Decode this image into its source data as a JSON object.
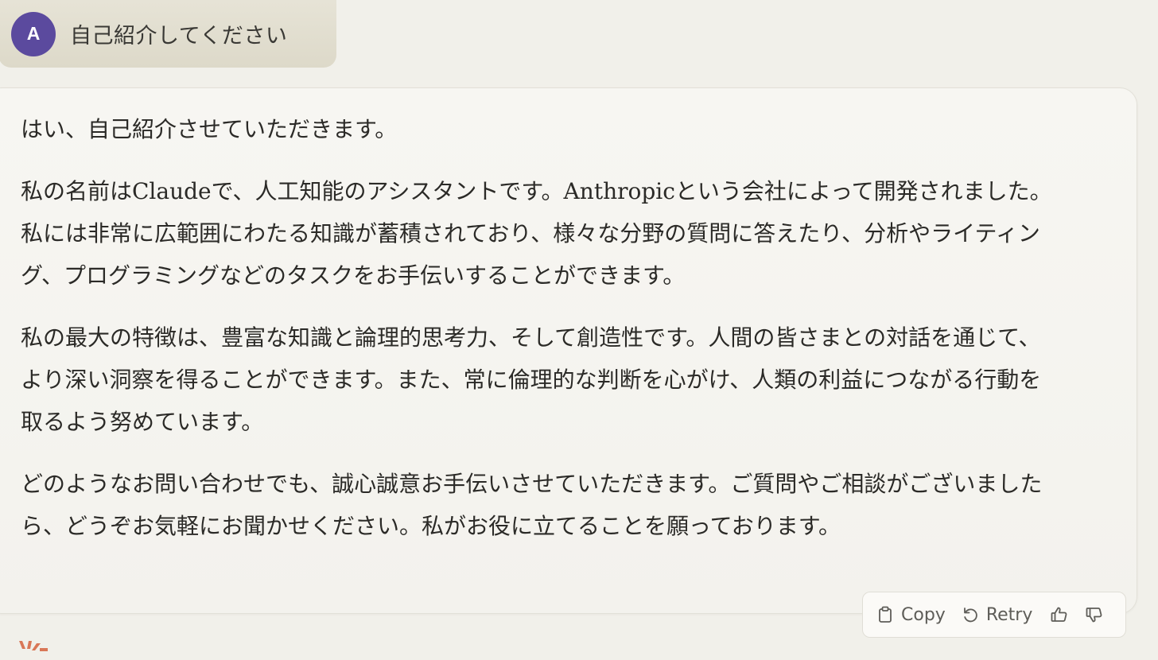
{
  "user_message": {
    "avatar_initial": "A",
    "text": "自己紹介してください"
  },
  "assistant_message": {
    "paragraphs": [
      "はい、自己紹介させていただきます。",
      "私の名前はClaudeで、人工知能のアシスタントです。Anthropicという会社によって開発されました。私には非常に広範囲にわたる知識が蓄積されており、様々な分野の質問に答えたり、分析やライティング、プログラミングなどのタスクをお手伝いすることができます。",
      "私の最大の特徴は、豊富な知識と論理的思考力、そして創造性です。人間の皆さまとの対話を通じて、より深い洞察を得ることができます。また、常に倫理的な判断を心がけ、人類の利益につながる行動を取るよう努めています。",
      "どのようなお問い合わせでも、誠心誠意お手伝いさせていただきます。ご質問やご相談がございましたら、どうぞお気軽にお聞かせください。私がお役に立てることを願っております。"
    ]
  },
  "actions": {
    "copy_label": "Copy",
    "retry_label": "Retry",
    "copy_icon": "clipboard-icon",
    "retry_icon": "retry-icon",
    "thumbs_up_icon": "thumbs-up-icon",
    "thumbs_down_icon": "thumbs-down-icon"
  },
  "colors": {
    "avatar_bg": "#5b4a9e",
    "page_bg": "#f1f0ea",
    "user_bubble_bg": "#e3e0d1",
    "logo": "#d97757"
  }
}
